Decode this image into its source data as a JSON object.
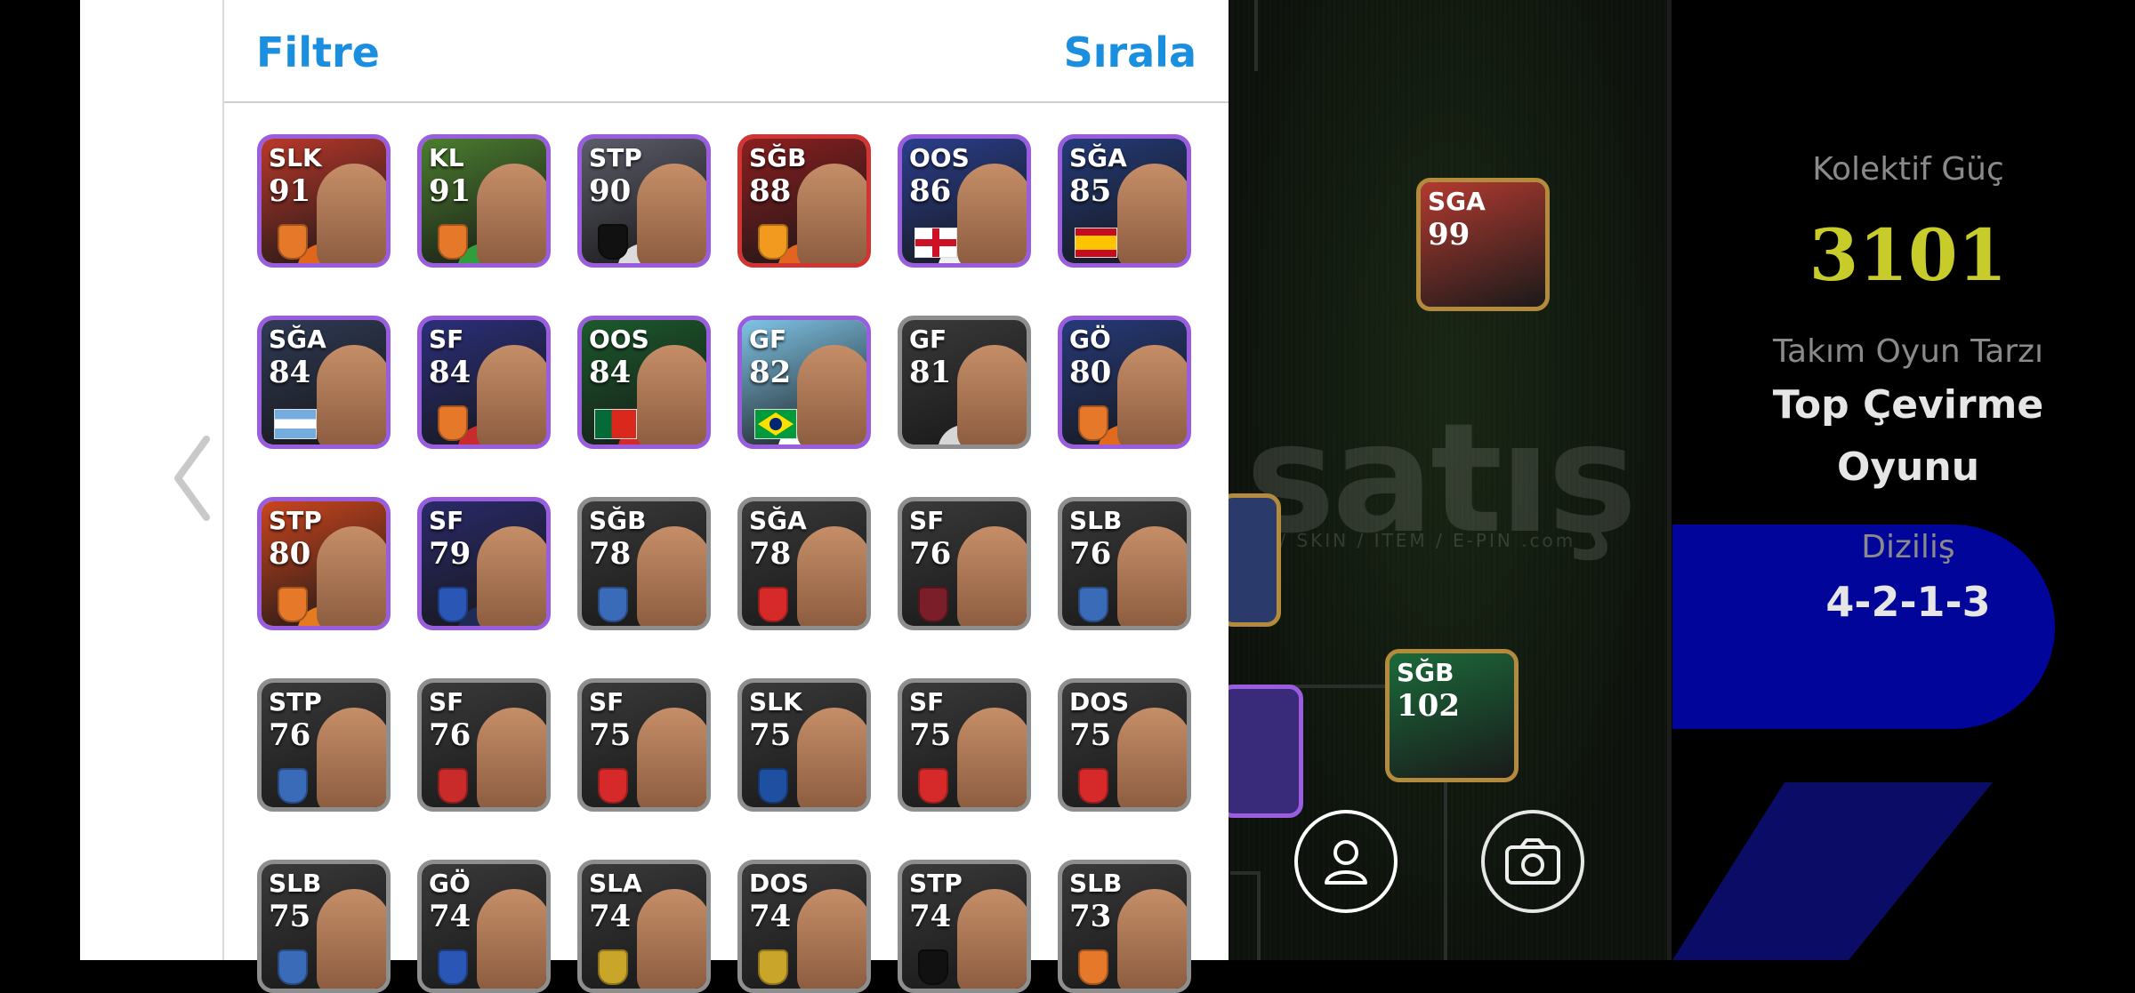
{
  "header": {
    "filter_label": "Filtre",
    "sort_label": "Sırala"
  },
  "players": [
    {
      "pos": "SLK",
      "rating": "91",
      "bg": "#b8382a",
      "shirt": "#e0661b",
      "frame": "#9a5de0",
      "mark": "badge",
      "mark_color": "#e6782a"
    },
    {
      "pos": "KL",
      "rating": "91",
      "bg": "#4b7d2f",
      "shirt": "#2f9e3b",
      "frame": "#9a5de0",
      "mark": "badge",
      "mark_color": "#e6782a"
    },
    {
      "pos": "STP",
      "rating": "90",
      "bg": "#5c5c6a",
      "shirt": "#dcdcdc",
      "frame": "#9a5de0",
      "mark": "badge",
      "mark_color": "#111111"
    },
    {
      "pos": "SĞB",
      "rating": "88",
      "bg": "#8b1f1f",
      "shirt": "#e1651e",
      "frame": "#d23434",
      "mark": "badge",
      "mark_color": "#f29a1f"
    },
    {
      "pos": "OOS",
      "rating": "86",
      "bg": "#2a3e8c",
      "shirt": "#f1f1f1",
      "frame": "#9a5de0",
      "mark": "flag-eng",
      "mark_color": ""
    },
    {
      "pos": "SĞA",
      "rating": "85",
      "bg": "#243a78",
      "shirt": "#1d1d2a",
      "frame": "#9a5de0",
      "mark": "flag-esp",
      "mark_color": ""
    },
    {
      "pos": "SĞA",
      "rating": "84",
      "bg": "#2f3a55",
      "shirt": "#1b1b1b",
      "frame": "#9a5de0",
      "mark": "flag-arg",
      "mark_color": ""
    },
    {
      "pos": "SF",
      "rating": "84",
      "bg": "#2b2f7a",
      "shirt": "#c72b2b",
      "frame": "#9a5de0",
      "mark": "badge",
      "mark_color": "#e6782a"
    },
    {
      "pos": "OOS",
      "rating": "84",
      "bg": "#1c5a2c",
      "shirt": "#d42a2a",
      "frame": "#9a5de0",
      "mark": "flag-por",
      "mark_color": ""
    },
    {
      "pos": "GF",
      "rating": "82",
      "bg": "#7fc4e6",
      "shirt": "#ffffff",
      "frame": "#9a5de0",
      "mark": "flag-bra",
      "mark_color": ""
    },
    {
      "pos": "GF",
      "rating": "81",
      "bg": "#3a3a3a",
      "shirt": "#d6d6d6",
      "frame": "#8e8e8e",
      "mark": "none",
      "mark_color": ""
    },
    {
      "pos": "GÖ",
      "rating": "80",
      "bg": "#263a7a",
      "shirt": "#e26a1d",
      "frame": "#9a5de0",
      "mark": "badge",
      "mark_color": "#e6782a"
    },
    {
      "pos": "STP",
      "rating": "80",
      "bg": "#c9451e",
      "shirt": "#e67a1f",
      "frame": "#9a5de0",
      "mark": "badge",
      "mark_color": "#e6782a"
    },
    {
      "pos": "SF",
      "rating": "79",
      "bg": "#2a2a6a",
      "shirt": "#1f2a55",
      "frame": "#9a5de0",
      "mark": "badge",
      "mark_color": "#2a56b5"
    },
    {
      "pos": "SĞB",
      "rating": "78",
      "bg": "#3a3a3a",
      "shirt": "#1e1e1e",
      "frame": "#8e8e8e",
      "mark": "badge",
      "mark_color": "#3a6bb8"
    },
    {
      "pos": "SĞA",
      "rating": "78",
      "bg": "#3a3a3a",
      "shirt": "#1e1e1e",
      "frame": "#8e8e8e",
      "mark": "badge",
      "mark_color": "#d62a2a"
    },
    {
      "pos": "SF",
      "rating": "76",
      "bg": "#3a3a3a",
      "shirt": "#1e1e1e",
      "frame": "#8e8e8e",
      "mark": "badge",
      "mark_color": "#7a1f2a"
    },
    {
      "pos": "SLB",
      "rating": "76",
      "bg": "#3a3a3a",
      "shirt": "#1e1e1e",
      "frame": "#8e8e8e",
      "mark": "badge",
      "mark_color": "#3a6bb8"
    },
    {
      "pos": "STP",
      "rating": "76",
      "bg": "#3a3a3a",
      "shirt": "#1e1e1e",
      "frame": "#8e8e8e",
      "mark": "badge",
      "mark_color": "#3a6bb8"
    },
    {
      "pos": "SF",
      "rating": "76",
      "bg": "#3a3a3a",
      "shirt": "#1e1e1e",
      "frame": "#8e8e8e",
      "mark": "badge",
      "mark_color": "#c92a2a"
    },
    {
      "pos": "SF",
      "rating": "75",
      "bg": "#3a3a3a",
      "shirt": "#1e1e1e",
      "frame": "#8e8e8e",
      "mark": "badge",
      "mark_color": "#d62a2a"
    },
    {
      "pos": "SLK",
      "rating": "75",
      "bg": "#3a3a3a",
      "shirt": "#1e1e1e",
      "frame": "#8e8e8e",
      "mark": "badge",
      "mark_color": "#1e4fa0"
    },
    {
      "pos": "SF",
      "rating": "75",
      "bg": "#3a3a3a",
      "shirt": "#1e1e1e",
      "frame": "#8e8e8e",
      "mark": "badge",
      "mark_color": "#d62a2a"
    },
    {
      "pos": "DOS",
      "rating": "75",
      "bg": "#3a3a3a",
      "shirt": "#1e1e1e",
      "frame": "#8e8e8e",
      "mark": "badge",
      "mark_color": "#d62a2a"
    },
    {
      "pos": "SLB",
      "rating": "75",
      "bg": "#3a3a3a",
      "shirt": "#1e1e1e",
      "frame": "#8e8e8e",
      "mark": "badge",
      "mark_color": "#3a6bb8"
    },
    {
      "pos": "GÖ",
      "rating": "74",
      "bg": "#3a3a3a",
      "shirt": "#1e1e1e",
      "frame": "#8e8e8e",
      "mark": "badge",
      "mark_color": "#2a56b5"
    },
    {
      "pos": "SLA",
      "rating": "74",
      "bg": "#3a3a3a",
      "shirt": "#1e1e1e",
      "frame": "#8e8e8e",
      "mark": "badge",
      "mark_color": "#c9a52a"
    },
    {
      "pos": "DOS",
      "rating": "74",
      "bg": "#3a3a3a",
      "shirt": "#1e1e1e",
      "frame": "#8e8e8e",
      "mark": "badge",
      "mark_color": "#c9a52a"
    },
    {
      "pos": "STP",
      "rating": "74",
      "bg": "#3a3a3a",
      "shirt": "#1e1e1e",
      "frame": "#8e8e8e",
      "mark": "badge",
      "mark_color": "#111111"
    },
    {
      "pos": "SLB",
      "rating": "73",
      "bg": "#3a3a3a",
      "shirt": "#1e1e1e",
      "frame": "#8e8e8e",
      "mark": "badge",
      "mark_color": "#e6782a"
    }
  ],
  "pitch_cards": [
    {
      "pos": "SGA",
      "rating": "99",
      "bg": "#b23a30",
      "frame": "#b48a3c"
    },
    {
      "pos": "SĞB",
      "rating": "102",
      "bg": "#1b6a3a",
      "frame": "#b48a3c"
    }
  ],
  "side": {
    "collective_label": "Kolektif Güç",
    "collective_value": "3101",
    "style_label": "Takım Oyun Tarzı",
    "style_line1": "Top Çevirme",
    "style_line2": "Oyunu",
    "formation_label": "Diziliş",
    "formation_value": "4-2-1-3"
  },
  "watermark": {
    "main": "satış",
    "sub": "TOP / SKIN / ITEM / E-PIN  .com"
  },
  "icons": {
    "back": "chevron-left-icon",
    "profile": "user-icon",
    "camera": "camera-icon"
  }
}
